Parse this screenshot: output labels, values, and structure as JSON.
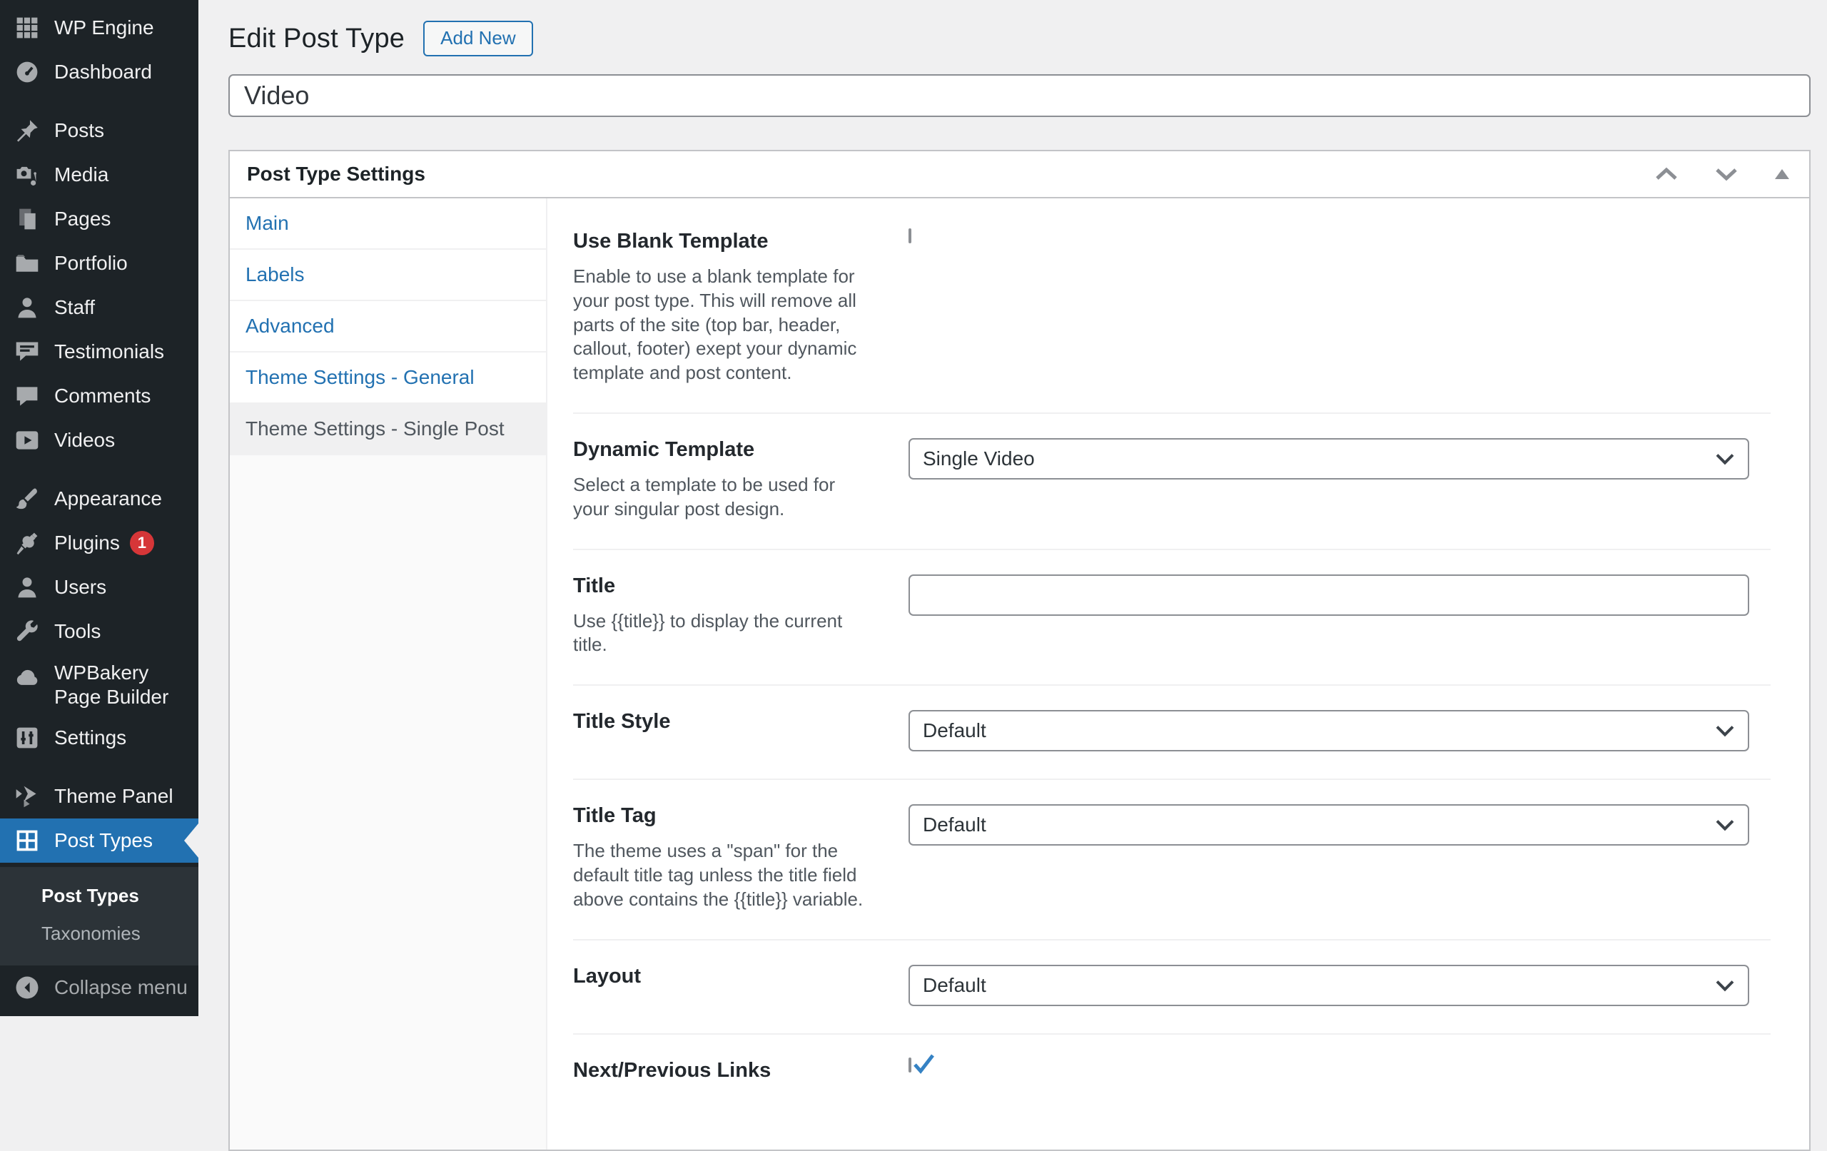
{
  "colors": {
    "accent": "#2271b1",
    "badge": "#d63638",
    "check_mark": "#3582c4",
    "sidebar_bg": "#1d2327",
    "page_bg": "#f0f0f1"
  },
  "sidebar": {
    "items": [
      {
        "label": "WP Engine"
      },
      {
        "label": "Dashboard"
      },
      {
        "label": "Posts"
      },
      {
        "label": "Media"
      },
      {
        "label": "Pages"
      },
      {
        "label": "Portfolio"
      },
      {
        "label": "Staff"
      },
      {
        "label": "Testimonials"
      },
      {
        "label": "Comments"
      },
      {
        "label": "Videos"
      },
      {
        "label": "Appearance"
      },
      {
        "label": "Plugins",
        "badge": "1"
      },
      {
        "label": "Users"
      },
      {
        "label": "Tools"
      },
      {
        "label": "WPBakery Page Builder"
      },
      {
        "label": "Settings"
      },
      {
        "label": "Theme Panel"
      },
      {
        "label": "Post Types",
        "active": true
      }
    ],
    "submenu": [
      {
        "label": "Post Types",
        "current": true
      },
      {
        "label": "Taxonomies",
        "current": false
      }
    ],
    "collapse_label": "Collapse menu"
  },
  "header": {
    "title": "Edit Post Type",
    "add_new_label": "Add New"
  },
  "name_input": {
    "value": "Video"
  },
  "metabox": {
    "title": "Post Type Settings",
    "tabs": [
      {
        "label": "Main",
        "active": false
      },
      {
        "label": "Labels",
        "active": false
      },
      {
        "label": "Advanced",
        "active": false
      },
      {
        "label": "Theme Settings - General",
        "active": false
      },
      {
        "label": "Theme Settings - Single Post",
        "active": true
      }
    ],
    "sections": [
      {
        "heading": "Use Blank Template",
        "description": "Enable to use a blank template for your post type. This will remove all parts of the site (top bar, header, callout, footer) exept your dynamic template and post content.",
        "control": "checkbox",
        "checked": false
      },
      {
        "heading": "Dynamic Template",
        "description": "Select a template to be used for your singular post design.",
        "control": "select",
        "value": "Single Video"
      },
      {
        "heading": "Title",
        "description": "Use {{title}} to display the current title.",
        "control": "text",
        "value": ""
      },
      {
        "heading": "Title Style",
        "description": "",
        "control": "select",
        "value": "Default"
      },
      {
        "heading": "Title Tag",
        "description": "The theme uses a \"span\" for the default title tag unless the title field above contains the {{title}} variable.",
        "control": "select",
        "value": "Default"
      },
      {
        "heading": "Layout",
        "description": "",
        "control": "select",
        "value": "Default"
      },
      {
        "heading": "Next/Previous Links",
        "description": "",
        "control": "checkbox",
        "checked": true
      }
    ]
  }
}
